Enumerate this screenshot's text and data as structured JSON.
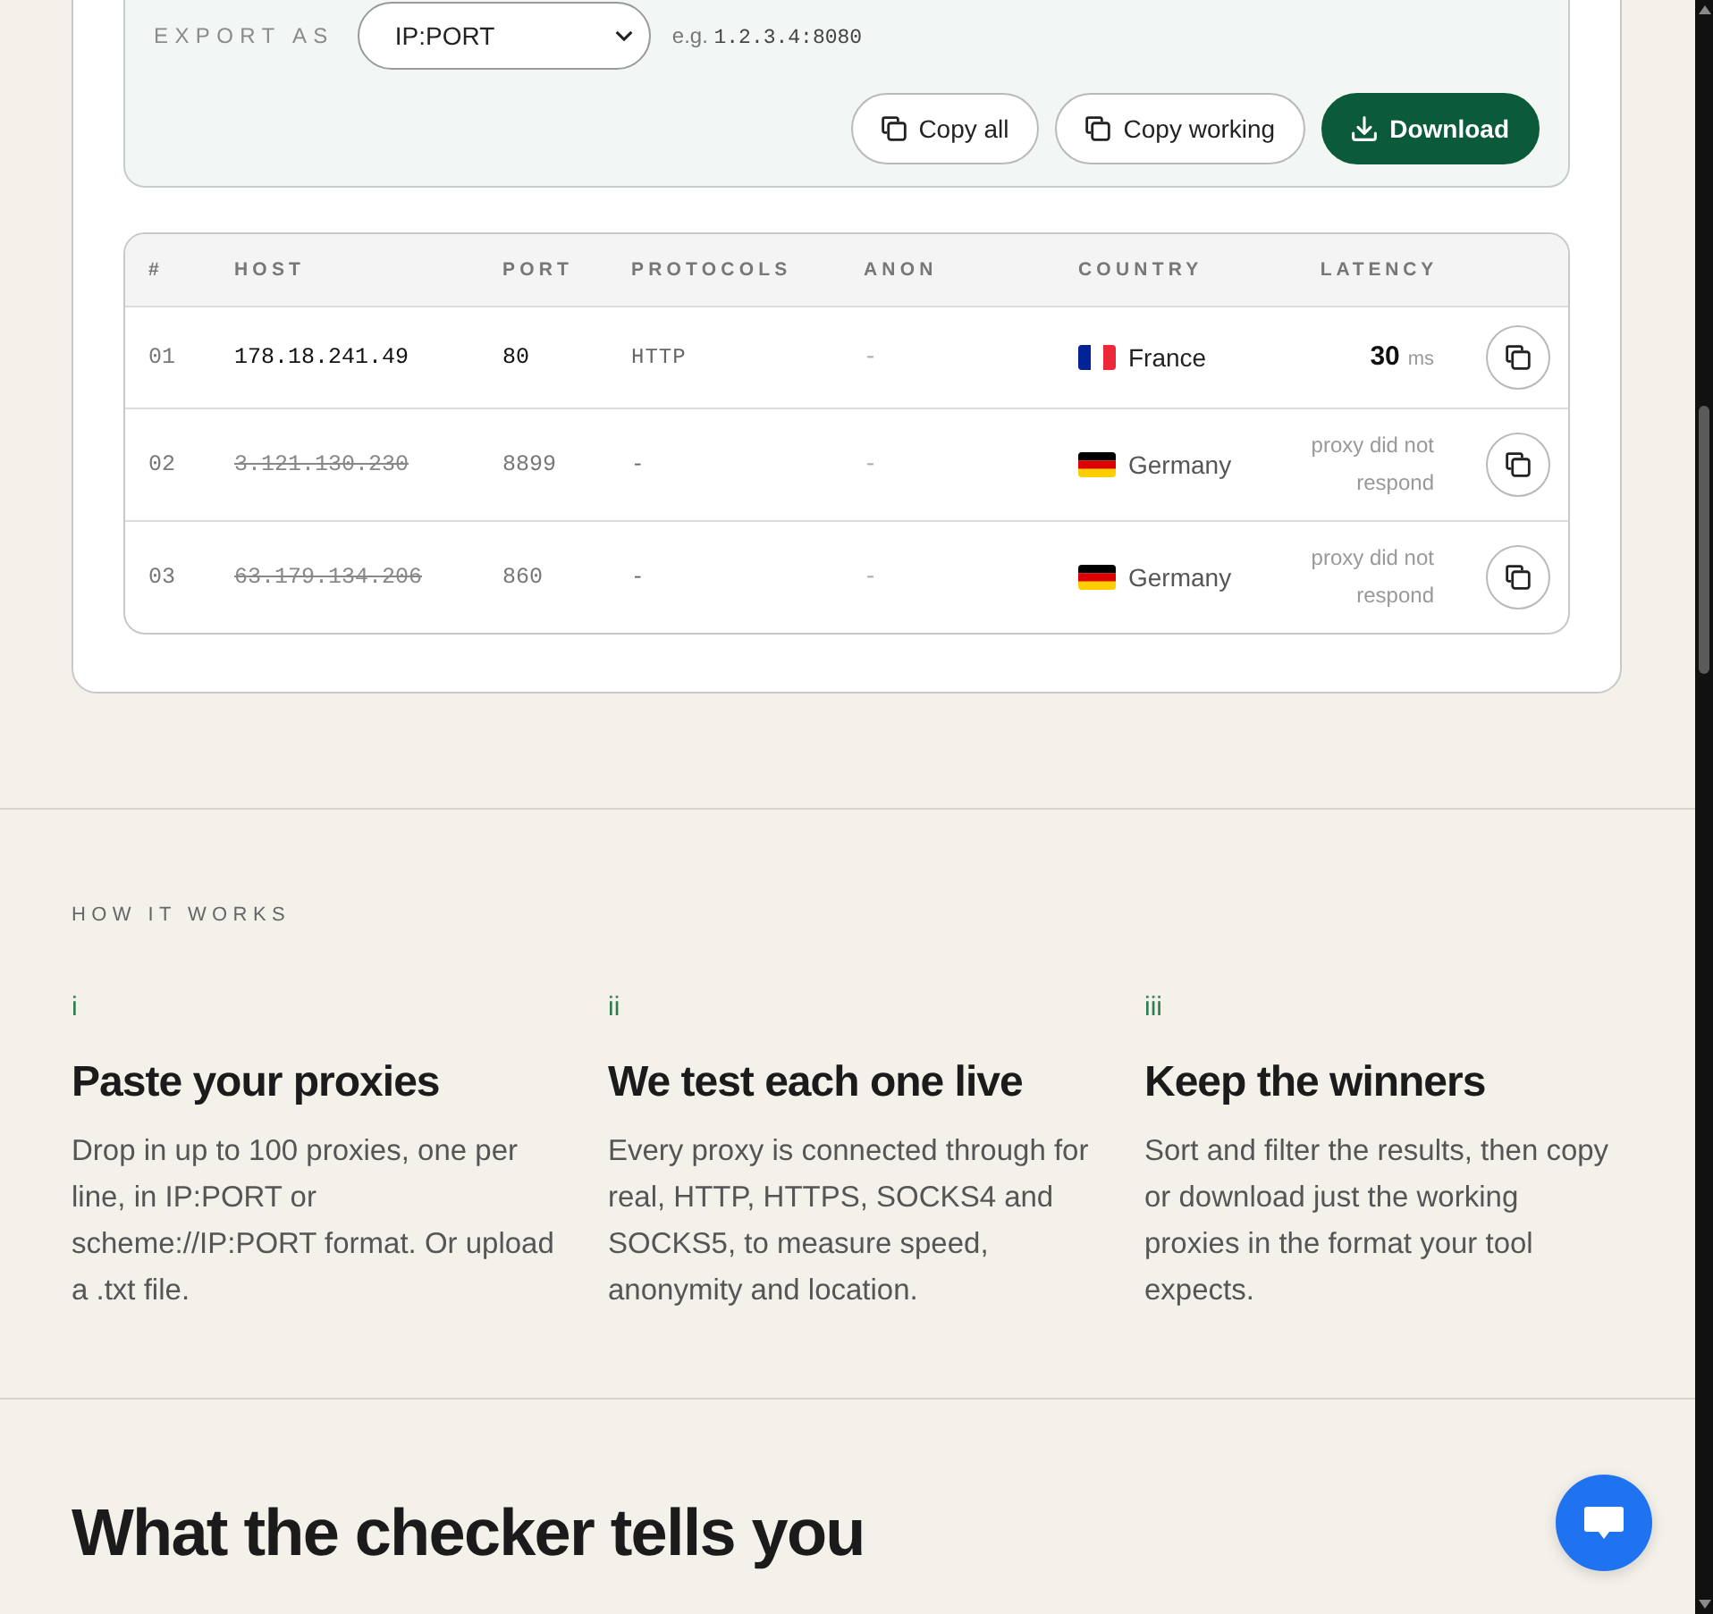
{
  "export": {
    "label": "EXPORT AS",
    "format": "IP:PORT",
    "example_prefix": "e.g.",
    "example_value": "1.2.3.4:8080",
    "buttons": [
      {
        "label": "Copy all",
        "kind": "outline"
      },
      {
        "label": "Copy working",
        "kind": "outline"
      },
      {
        "label": "Download",
        "kind": "primary"
      }
    ]
  },
  "table": {
    "columns": [
      "#",
      "HOST",
      "PORT",
      "PROTOCOLS",
      "ANON",
      "COUNTRY",
      "LATENCY"
    ],
    "rows": [
      {
        "index": "01",
        "host": "178.18.241.49",
        "port": "80",
        "protocols": "HTTP",
        "anon": "-",
        "country": "France",
        "flag": {
          "kind": "vertical",
          "stripes": [
            {
              "color": "#002395"
            },
            {
              "color": "#ffffff"
            },
            {
              "color": "#ed2939"
            }
          ]
        },
        "working": true,
        "latency": {
          "kind": "value",
          "value": "30",
          "unit": "ms"
        }
      },
      {
        "index": "02",
        "host": "3.121.130.230",
        "port": "8899",
        "protocols": "-",
        "anon": "-",
        "country": "Germany",
        "flag": {
          "kind": "horizontal",
          "stripes": [
            {
              "color": "#000000"
            },
            {
              "color": "#dd0000"
            },
            {
              "color": "#ffce00"
            }
          ]
        },
        "working": false,
        "latency": {
          "kind": "note",
          "text": "proxy did not respond"
        }
      },
      {
        "index": "03",
        "host": "63.179.134.206",
        "port": "860",
        "protocols": "-",
        "anon": "-",
        "country": "Germany",
        "flag": {
          "kind": "horizontal",
          "stripes": [
            {
              "color": "#000000"
            },
            {
              "color": "#dd0000"
            },
            {
              "color": "#ffce00"
            }
          ]
        },
        "working": false,
        "latency": {
          "kind": "note",
          "text": "proxy did not respond"
        }
      }
    ]
  },
  "how_it_works": {
    "label": "HOW IT WORKS",
    "steps": [
      {
        "numeral": "i",
        "title": "Paste your proxies",
        "text": "Drop in up to 100 proxies, one per line, in IP:PORT or scheme://IP:PORT format. Or upload a .txt file."
      },
      {
        "numeral": "ii",
        "title": "We test each one live",
        "text": "Every proxy is connected through for real, HTTP, HTTPS, SOCKS4 and SOCKS5, to measure speed, anonymity and location."
      },
      {
        "numeral": "iii",
        "title": "Keep the winners",
        "text": "Sort and filter the results, then copy or download just the working proxies in the format your tool expects."
      }
    ]
  },
  "checker_section": {
    "title": "What the checker tells you"
  }
}
